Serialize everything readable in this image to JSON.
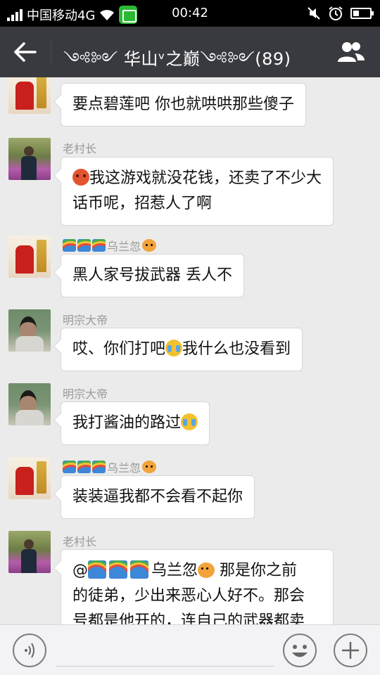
{
  "status_bar": {
    "carrier": "中国移动4G",
    "time": "00:42"
  },
  "header": {
    "title": "༺༻ 华山ᵛ之巅༺༻(89)"
  },
  "messages": [
    {
      "text": "要点碧莲吧 你也就哄哄那些傻子"
    },
    {
      "sender": "老村长",
      "text": "我这游戏就没花钱，还卖了不少大话币呢，招惹人了啊"
    },
    {
      "sender": "乌兰忽",
      "text": "黑人家号拔武器 丢人不"
    },
    {
      "sender": "明宗大帝",
      "text_before": "哎、你们打吧",
      "text_after": "我什么也没看到"
    },
    {
      "sender": "明宗大帝",
      "text": "我打酱油的路过"
    },
    {
      "sender": "乌兰忽",
      "text": "装装逼我都不会看不起你"
    },
    {
      "sender": "老村长",
      "at": "@",
      "mention": "乌兰忽",
      "text_line1": " 那是你之前",
      "text_line2": "的徒弟，少出来恶心人好不。那会",
      "text_line3": "号都是他开的，连自己的武器都卖"
    }
  ],
  "icons": {
    "back": "back-arrow-icon",
    "group": "group-members-icon",
    "voice": "voice-icon",
    "emoji": "emoji-face-icon",
    "plus": "plus-icon"
  },
  "colors": {
    "header_bg": "#393a3f",
    "chat_bg": "#ebebeb",
    "status_bg": "#000000"
  }
}
